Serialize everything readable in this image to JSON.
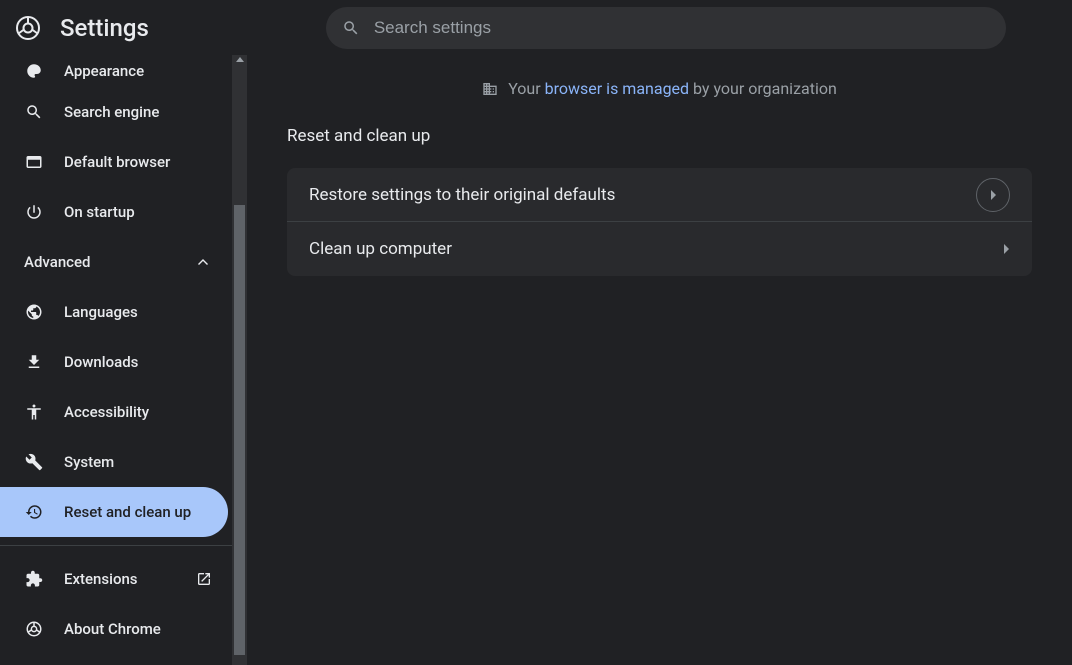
{
  "header": {
    "title": "Settings",
    "search_placeholder": "Search settings"
  },
  "sidebar": {
    "items": [
      {
        "label": "Appearance",
        "icon": "palette"
      },
      {
        "label": "Search engine",
        "icon": "search"
      },
      {
        "label": "Default browser",
        "icon": "browser"
      },
      {
        "label": "On startup",
        "icon": "power"
      }
    ],
    "advanced_label": "Advanced",
    "advanced_items": [
      {
        "label": "Languages",
        "icon": "globe"
      },
      {
        "label": "Downloads",
        "icon": "download"
      },
      {
        "label": "Accessibility",
        "icon": "accessibility"
      },
      {
        "label": "System",
        "icon": "wrench"
      },
      {
        "label": "Reset and clean up",
        "icon": "restore",
        "selected": true
      }
    ],
    "footer_items": [
      {
        "label": "Extensions",
        "icon": "extension",
        "external": true
      },
      {
        "label": "About Chrome",
        "icon": "chrome"
      }
    ]
  },
  "content": {
    "managed_prefix": "Your",
    "managed_link": "browser is managed",
    "managed_suffix": "by your organization",
    "section_title": "Reset and clean up",
    "rows": [
      {
        "label": "Restore settings to their original defaults",
        "style": "circle"
      },
      {
        "label": "Clean up computer",
        "style": "arrow"
      }
    ]
  }
}
